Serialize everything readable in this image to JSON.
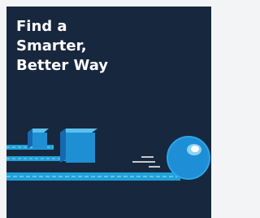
{
  "banner": {
    "headline_lines": [
      "Find a",
      "Smarter,",
      "Better Way"
    ]
  },
  "colors": {
    "background": "#17273d",
    "headline": "#ffffff",
    "track": "#1fa0d8",
    "track_dash": "#8fd3f0",
    "cube_front": "#1f8fd3",
    "cube_side": "#1569b0",
    "cube_top": "#5cc0ee",
    "ball": "#1e8fd6",
    "ball_highlight": "#ffffff",
    "speed_lines": "#ffffff"
  },
  "icons": {
    "cubes": "stair-cubes-illustration",
    "ball": "rolling-ball-illustration",
    "motion": "speed-lines-icon"
  }
}
